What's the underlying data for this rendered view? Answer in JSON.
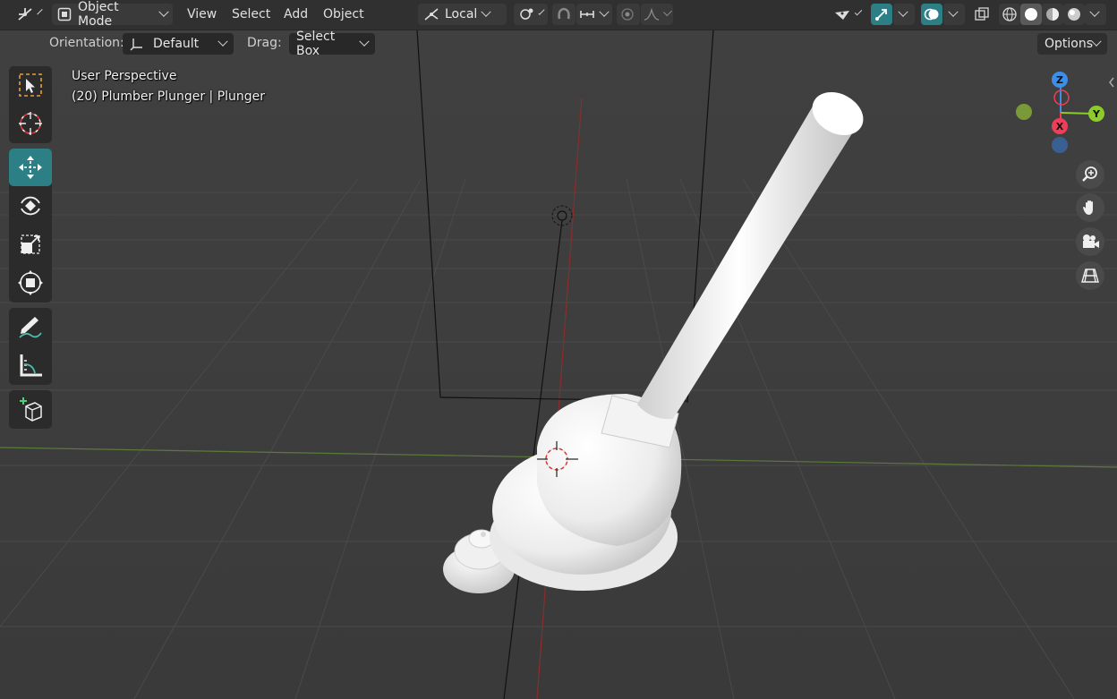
{
  "header": {
    "editor_type_icon": "axes-editor-icon",
    "mode_icon": "object-mode-icon",
    "mode_label": "Object Mode",
    "menus": [
      "View",
      "Select",
      "Add",
      "Object"
    ],
    "transform_orientation": "Local",
    "pivot_icon": "pivot-point-icon",
    "snap_icon": "magnet-snap-icon",
    "snap_target_icon": "snap-increment-icon",
    "proportional_icon": "proportional-edit-icon",
    "falloff_icon": "falloff-curve-icon",
    "visibility_icon": "selectability-visibility-icon",
    "gizmo_icon": "gizmo-icon",
    "overlay_icon": "overlay-icon",
    "xray_icon": "xray-icon",
    "shading_modes": [
      "wireframe-shading-icon",
      "solid-shading-icon",
      "material-shading-icon",
      "rendered-shading-icon"
    ],
    "active_shading": "solid-shading-icon"
  },
  "tool_settings": {
    "orientation_label": "Orientation:",
    "orientation_value": "Default",
    "drag_label": "Drag:",
    "drag_value": "Select Box",
    "options_label": "Options"
  },
  "toolbar": {
    "tools": [
      "select-box-tool",
      "cursor-tool",
      "move-tool",
      "rotate-tool",
      "scale-tool",
      "transform-tool",
      "annotate-tool",
      "measure-tool",
      "add-cube-tool"
    ],
    "active_tool": "move-tool"
  },
  "viewport": {
    "view_name": "User Perspective",
    "object_info": "(20) Plumber Plunger | Plunger"
  },
  "navigation": {
    "axes": {
      "z": "Z",
      "y": "Y",
      "x": "X"
    },
    "buttons": [
      "zoom-icon",
      "hand-pan-icon",
      "camera-icon",
      "ortho-grid-icon"
    ]
  },
  "colors": {
    "header_bg": "#303030",
    "viewport_bg": "#3d3d3d",
    "accent": "#2d7f86",
    "x_axis": "#ee3f5a",
    "y_axis": "#8ccb2c",
    "z_axis": "#3c8ee8"
  }
}
